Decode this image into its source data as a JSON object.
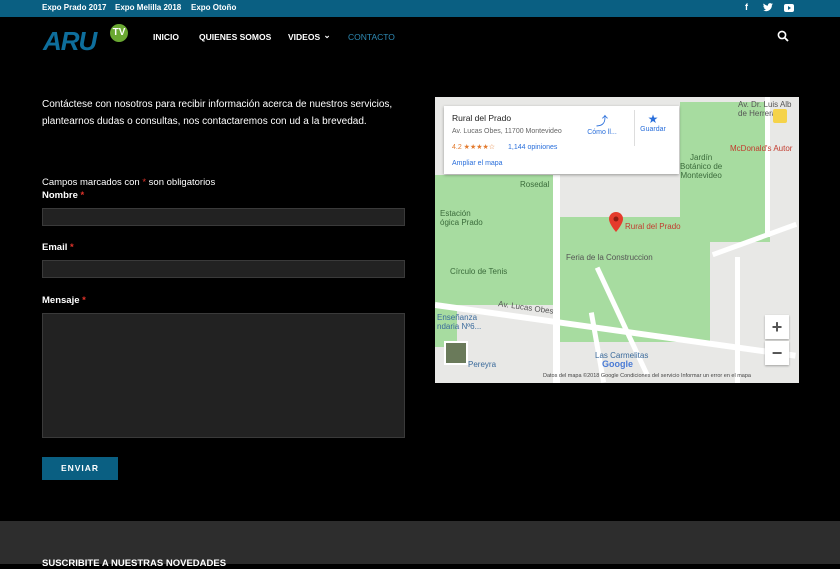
{
  "topbar": {
    "links": [
      "Expo Prado 2017",
      "Expo Melilla 2018",
      "Expo Otoño"
    ],
    "social_icons": [
      "facebook-icon",
      "twitter-icon",
      "youtube-icon"
    ],
    "social_glyphs": [
      "f",
      "t",
      "▶"
    ]
  },
  "logo": {
    "text": "ARU",
    "badge": "TV"
  },
  "nav": {
    "items": [
      "INICIO",
      "QUIENES SOMOS",
      "VIDEOS",
      "CONTACTO"
    ],
    "videos_chevron": "⌄",
    "active": "CONTACTO"
  },
  "intro": "Contáctese con nosotros para recibir información acerca de nuestros servicios, plantearnos dudas o consultas, nos contactaremos con ud a la brevedad.",
  "form": {
    "required_note_prefix": "Campos marcados con",
    "required_star": "*",
    "required_note_suffix": "son obligatorios",
    "name_label": "Nombre",
    "email_label": "Email",
    "message_label": "Mensaje",
    "submit_label": "ENVIAR"
  },
  "map": {
    "card": {
      "title": "Rural del Prado",
      "address": "Av. Lucas Obes, 11700 Montevideo",
      "rating": "4.2 ★★★★☆",
      "reviews": "1,144 opiniones",
      "enlarge": "Ampliar el mapa",
      "directions": "Cómo ll...",
      "save": "Guardar"
    },
    "labels": {
      "rural": "Rural del Prado",
      "feria": "Feria de la Construccion",
      "circulo": "Círculo de Tenis",
      "estacion": "Estación\nógica Prado",
      "rosedal": "Rosedal",
      "jardin": "Jardín\nBotánico de\nMontevideo",
      "mcd": "McDonald's Autor",
      "lucas": "Av. Lucas Obes",
      "carmelitas": "Las Carmelitas",
      "ensenanza": "Enseñanza\nndaria Nº6...",
      "pereyra": "Pereyra",
      "alberto": "Av. Dr. Luis Alb\nde Herrera",
      "google": "Google"
    },
    "attribution": "Datos del mapa ©2018 Google    Condiciones del servicio    Informar un error en el mapa",
    "zoom_in": "+",
    "zoom_out": "−"
  },
  "footer": {
    "title": "SUSCRIBITE A NUESTRAS NOVEDADES"
  }
}
